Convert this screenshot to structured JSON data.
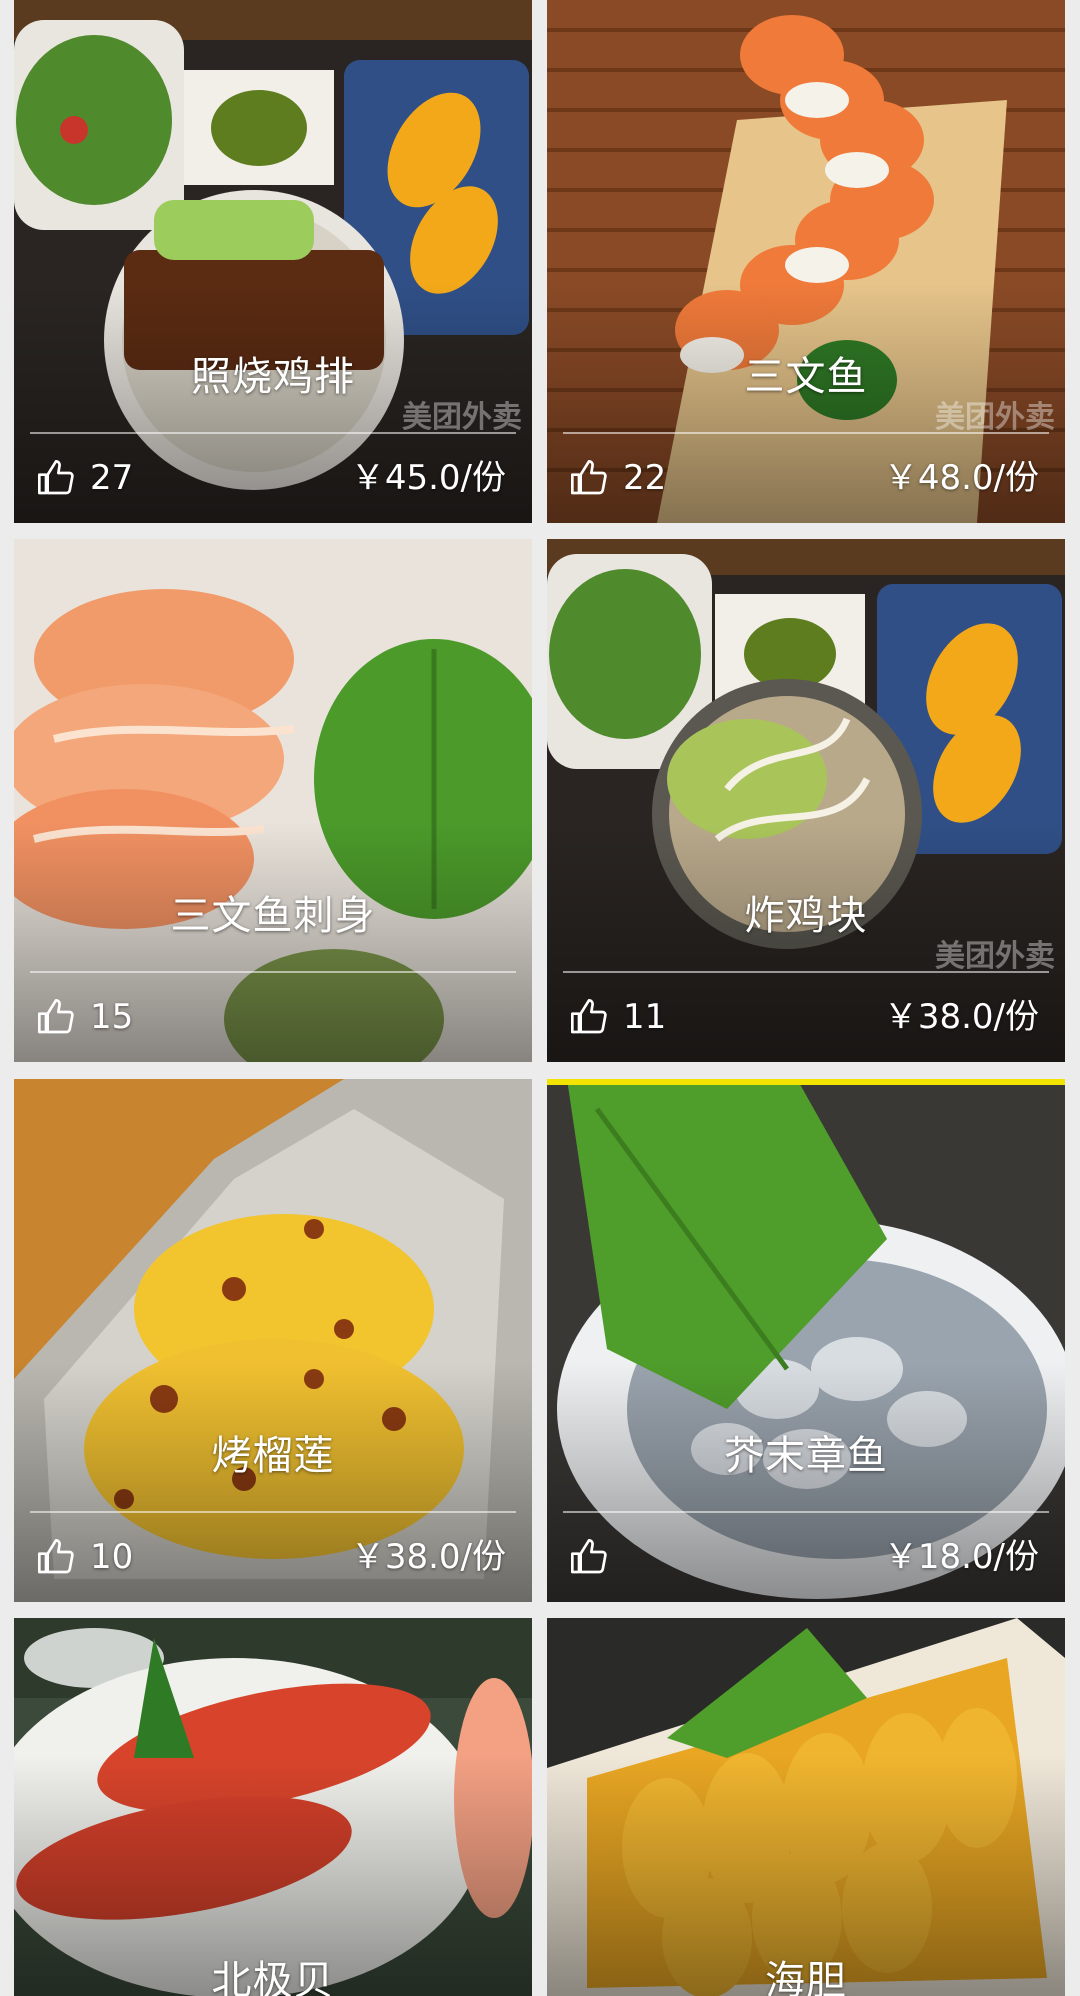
{
  "items": [
    {
      "name": "照烧鸡排",
      "likes": "27",
      "price": "￥45.0/份",
      "watermark": "美团外卖",
      "image": "teriyaki-chicken-plate-photo"
    },
    {
      "name": "三文鱼",
      "likes": "22",
      "price": "￥48.0/份",
      "watermark": "美团外卖",
      "image": "salmon-roll-photo"
    },
    {
      "name": "三文鱼刺身",
      "likes": "15",
      "price": "",
      "watermark": "",
      "image": "salmon-sashimi-photo"
    },
    {
      "name": "炸鸡块",
      "likes": "11",
      "price": "￥38.0/份",
      "watermark": "美团外卖",
      "image": "fried-chicken-bowl-photo"
    },
    {
      "name": "烤榴莲",
      "likes": "10",
      "price": "￥38.0/份",
      "watermark": "",
      "image": "grilled-durian-photo"
    },
    {
      "name": "芥末章鱼",
      "likes": "",
      "price": "￥18.0/份",
      "watermark": "",
      "image": "wasabi-octopus-photo"
    },
    {
      "name": "北极贝",
      "likes": "",
      "price": "",
      "watermark": "",
      "image": "surf-clam-sushi-photo"
    },
    {
      "name": "海胆",
      "likes": "",
      "price": "",
      "watermark": "",
      "image": "sea-urchin-photo"
    }
  ],
  "icons": {
    "like": "thumbs-up-icon"
  },
  "colors": {
    "text": "#ffffff",
    "background": "#ececec",
    "accent": "#f2e400"
  }
}
